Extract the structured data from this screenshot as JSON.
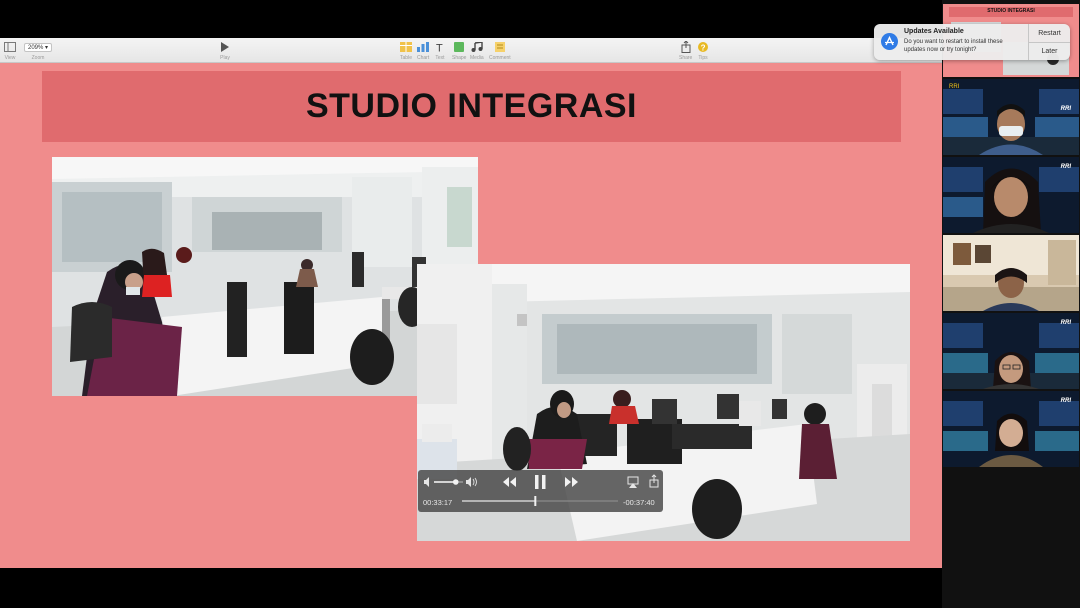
{
  "toolbar": {
    "view_label": "View",
    "zoom_value": "209%",
    "zoom_label": "Zoom",
    "play_label": "Play",
    "table_label": "Table",
    "chart_label": "Chart",
    "text_label": "Text",
    "shape_label": "Shape",
    "media_label": "Media",
    "comment_label": "Comment",
    "share_label": "Share",
    "tips_label": "Tips"
  },
  "slide": {
    "title": "STUDIO INTEGRASI"
  },
  "video": {
    "elapsed": "00:33:17",
    "remaining": "-00:37:40",
    "progress": 0.47,
    "volume": 0.75
  },
  "notification": {
    "title": "Updates Available",
    "body": "Do you want to restart to install these updates now or try tonight?",
    "restart_label": "Restart",
    "later_label": "Later"
  },
  "participants": {
    "top_tile_text": "STUDIO INTEGRASI",
    "rri_logo_text": "RRI",
    "channel_text": "RRI",
    "count": 6
  },
  "colors": {
    "slide_bg": "#f08c8c",
    "title_band": "#e06b6e",
    "accent_blue": "#2f7be6"
  }
}
